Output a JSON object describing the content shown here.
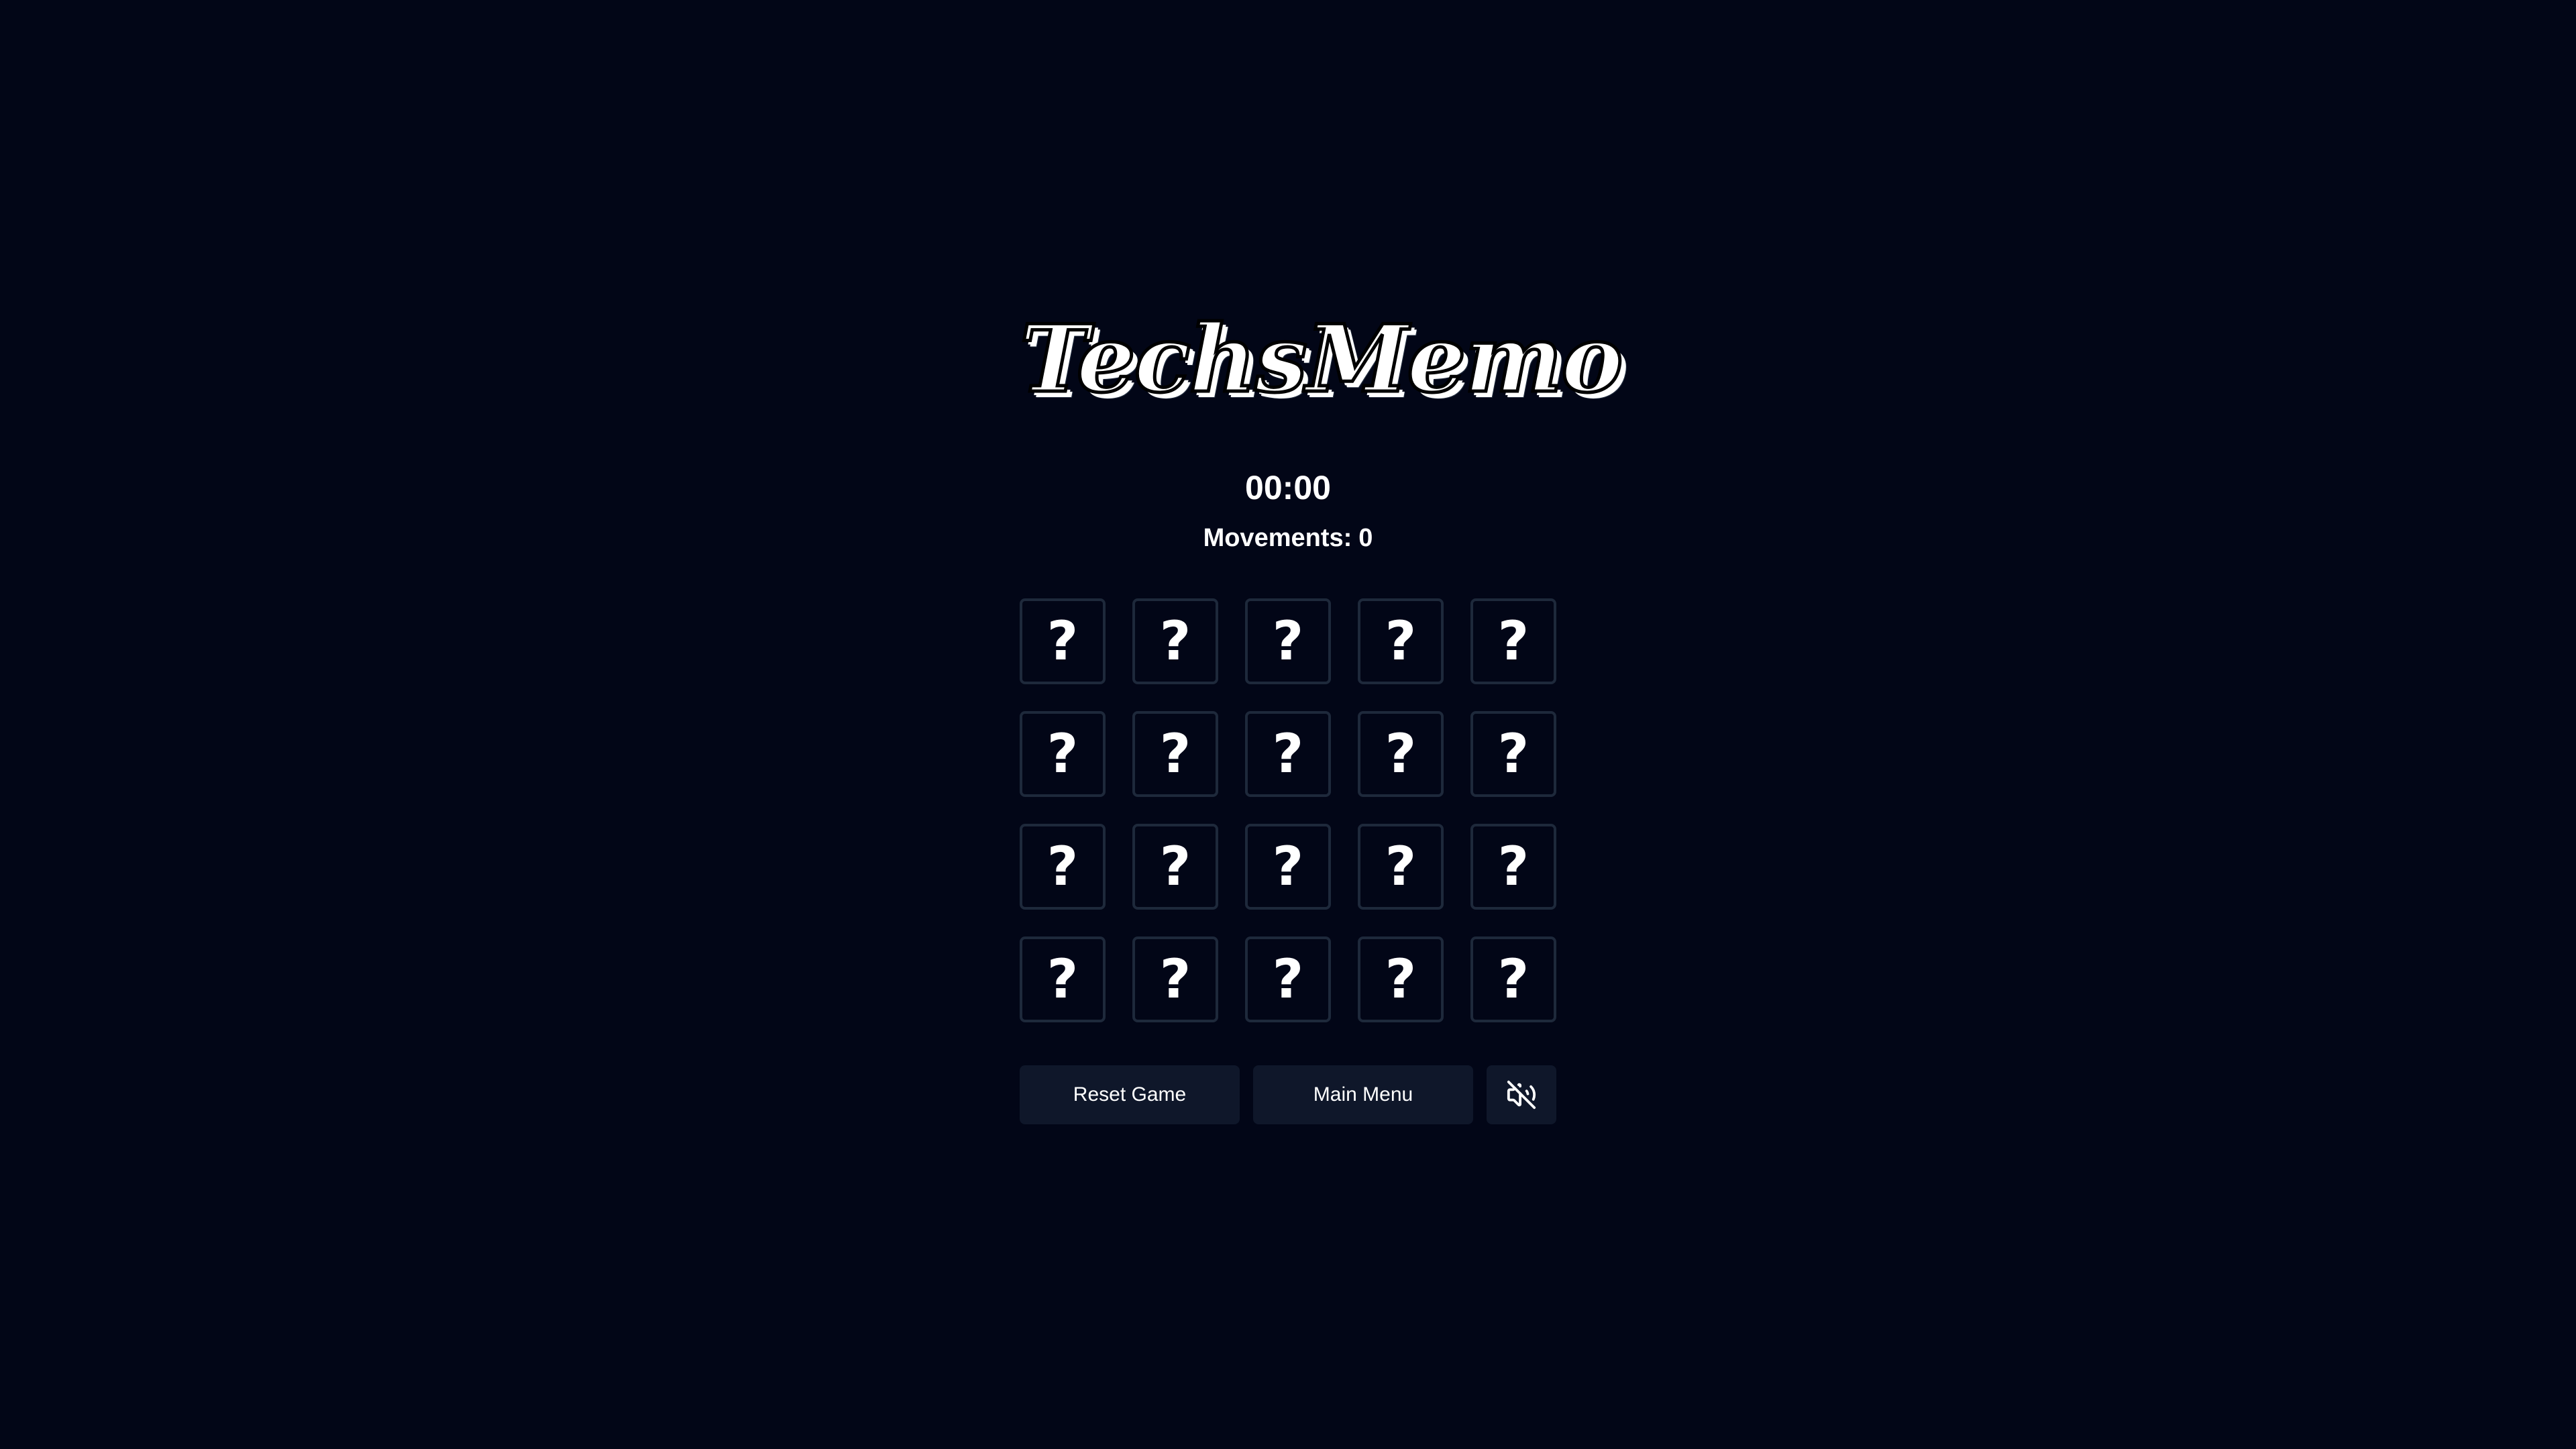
{
  "app": {
    "title": "TechsMemo"
  },
  "status": {
    "timer": "00:00",
    "movements_label": "Movements:",
    "movements_value": "0"
  },
  "board": {
    "rows": 4,
    "columns": 5,
    "card_face_down_symbol": "?"
  },
  "controls": {
    "reset_label": "Reset Game",
    "main_menu_label": "Main Menu",
    "sound_icon": "speaker-muted-icon"
  },
  "colors": {
    "background": "#020617",
    "card_border": "#1e293b",
    "button_background": "#0f172a",
    "text": "#ffffff"
  }
}
